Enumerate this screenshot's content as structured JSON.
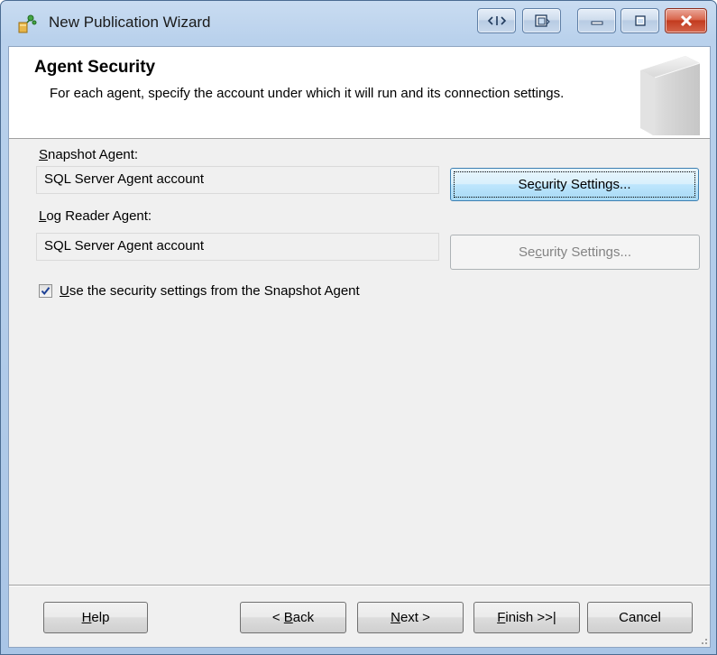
{
  "window": {
    "title": "New Publication Wizard"
  },
  "header": {
    "title": "Agent Security",
    "description": "For each agent, specify the account under which it will run and its connection settings."
  },
  "snapshot_agent": {
    "label_access_key": "S",
    "label_rest": "napshot Agent:",
    "account": "SQL Server Agent account",
    "button_pre": "Se",
    "button_key": "c",
    "button_post": "urity Settings..."
  },
  "log_reader_agent": {
    "label_access_key": "L",
    "label_rest": "og Reader Agent:",
    "account": "SQL Server Agent account",
    "button_pre": "Se",
    "button_key": "c",
    "button_post": "urity Settings...",
    "button_enabled": false
  },
  "use_snapshot_settings": {
    "checked": true,
    "label_access_key": "U",
    "label_rest": "se the security settings from the Snapshot Agent"
  },
  "footer": {
    "help_key": "H",
    "help_rest": "elp",
    "back_pre": "< ",
    "back_key": "B",
    "back_rest": "ack",
    "next_key": "N",
    "next_rest": "ext >",
    "finish_key": "F",
    "finish_rest": "inish >>|",
    "cancel_label": "Cancel"
  },
  "colors": {
    "frame": "#a9c5e6",
    "close_button": "#c23b1f",
    "focus_button": "#bee6fd"
  },
  "icons": {
    "app": "publication-wizard-icon",
    "caption": [
      "code-icon",
      "restore-window-icon",
      "minimize-icon",
      "maximize-icon",
      "close-icon"
    ]
  }
}
